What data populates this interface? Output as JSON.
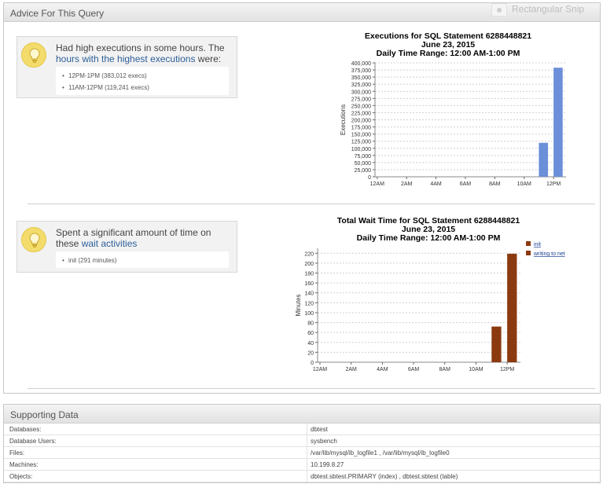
{
  "advice_panel": {
    "title": "Advice For This Query",
    "overlay_text": "Rectangular Snip",
    "executions_advice": {
      "text": "Had high executions in some hours. The",
      "link": "hours with the highest executions",
      "suffix": " were:",
      "items": [
        "12PM-1PM (383,012 execs)",
        "11AM-12PM (119,241 execs)"
      ]
    },
    "wait_advice": {
      "text": "Spent a significant amount of time on these",
      "link": "wait activities",
      "items": [
        "init (291 minutes)"
      ]
    }
  },
  "support_panel": {
    "title": "Supporting Data",
    "rows": [
      {
        "key": "Databases:",
        "value": "dbtest"
      },
      {
        "key": "Database Users:",
        "value": "sysbench"
      },
      {
        "key": "Files:",
        "value": "/var/lib/mysql/ib_logfile1  ,  /var/lib/mysql/ib_logfile0"
      },
      {
        "key": "Machines:",
        "value": "10.199.8.27"
      },
      {
        "key": "Objects:",
        "value": "dbtest.sbtest.PRIMARY (index)  ,  dbtest.sbtest (table)"
      }
    ]
  },
  "chart_data": [
    {
      "type": "bar",
      "title": "Executions for SQL Statement 6288448821",
      "subtitle": "June 23, 2015",
      "subtitle2": "Daily Time Range: 12:00 AM-1:00 PM",
      "ylabel": "Executions",
      "xlabel": "",
      "ylim": [
        0,
        400000
      ],
      "yticks": [
        0,
        25000,
        50000,
        75000,
        100000,
        125000,
        150000,
        175000,
        200000,
        225000,
        250000,
        275000,
        300000,
        325000,
        350000,
        375000,
        400000
      ],
      "ytick_labels": [
        "0",
        "25,000",
        "50,000",
        "75,000",
        "100,000",
        "125,000",
        "150,000",
        "175,000",
        "200,000",
        "225,000",
        "250,000",
        "275,000",
        "300,000",
        "325,000",
        "350,000",
        "375,000",
        "400,000"
      ],
      "xtick_labels": [
        "12AM",
        "2AM",
        "4AM",
        "6AM",
        "8AM",
        "10AM",
        "12PM"
      ],
      "categories": [
        "12AM",
        "1AM",
        "2AM",
        "3AM",
        "4AM",
        "5AM",
        "6AM",
        "7AM",
        "8AM",
        "9AM",
        "10AM",
        "11AM",
        "12PM"
      ],
      "values": [
        0,
        0,
        0,
        0,
        0,
        0,
        0,
        0,
        0,
        0,
        0,
        119241,
        383012
      ],
      "color": "#6b8fd8",
      "grid": true
    },
    {
      "type": "bar",
      "title": "Total Wait Time for SQL Statement 6288448821",
      "subtitle": "June 23, 2015",
      "subtitle2": "Daily Time Range: 12:00 AM-1:00 PM",
      "ylabel": "Minutes",
      "xlabel": "",
      "ylim": [
        0,
        230
      ],
      "yticks": [
        0,
        20,
        40,
        60,
        80,
        100,
        120,
        140,
        160,
        180,
        200,
        220
      ],
      "ytick_labels": [
        "0",
        "20",
        "40",
        "60",
        "80",
        "100",
        "120",
        "140",
        "160",
        "180",
        "200",
        "220"
      ],
      "xtick_labels": [
        "12AM",
        "2AM",
        "4AM",
        "6AM",
        "8AM",
        "10AM",
        "12PM"
      ],
      "categories": [
        "12AM",
        "1AM",
        "2AM",
        "3AM",
        "4AM",
        "5AM",
        "6AM",
        "7AM",
        "8AM",
        "9AM",
        "10AM",
        "11AM",
        "12PM"
      ],
      "series": [
        {
          "name": "init",
          "values": [
            0,
            0,
            0,
            0,
            0,
            0,
            0,
            0,
            0,
            0,
            0,
            72,
            219
          ],
          "color": "#8b3a0f"
        },
        {
          "name": "writing to net",
          "values": [
            0,
            0,
            0,
            0,
            0,
            0,
            0,
            0,
            0,
            0,
            0,
            0,
            0
          ],
          "color": "#8b3a0f"
        }
      ],
      "legend": "right",
      "grid": true
    }
  ]
}
